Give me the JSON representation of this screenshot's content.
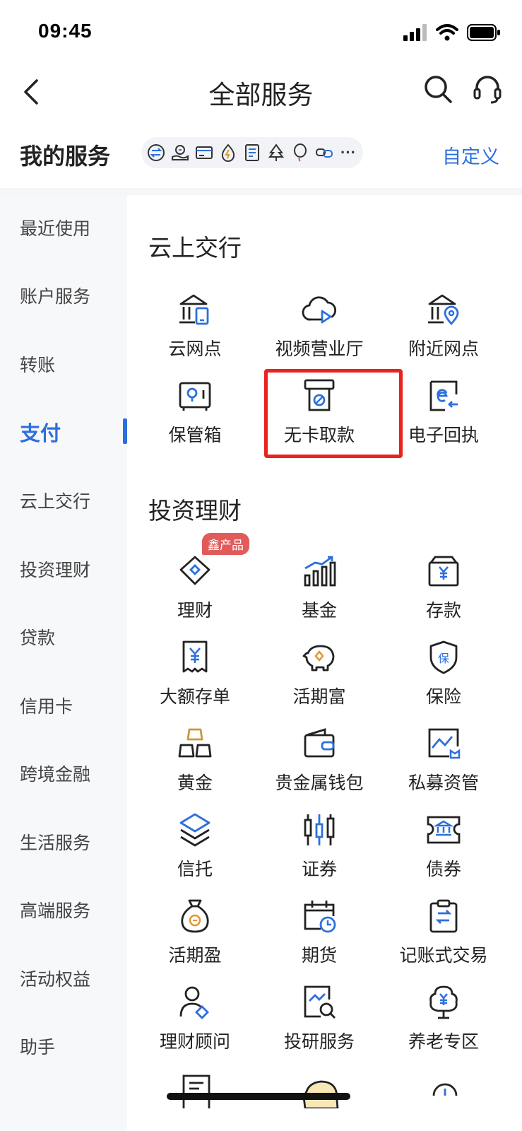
{
  "status_bar": {
    "time": "09:45"
  },
  "nav": {
    "title": "全部服务"
  },
  "my_services": {
    "title": "我的服务",
    "customize_label": "自定义",
    "icons": [
      "transfer-icon",
      "piggy-hand-icon",
      "card-icon",
      "lightning-drop-icon",
      "document-icon",
      "tree-icon",
      "balloon-icon",
      "link-icon"
    ],
    "more_label": "···"
  },
  "sidebar": {
    "items": [
      {
        "label": "最近使用"
      },
      {
        "label": "账户服务"
      },
      {
        "label": "转账"
      },
      {
        "label": "支付"
      },
      {
        "label": "云上交行"
      },
      {
        "label": "投资理财"
      },
      {
        "label": "贷款"
      },
      {
        "label": "信用卡"
      },
      {
        "label": "跨境金融"
      },
      {
        "label": "生活服务"
      },
      {
        "label": "高端服务"
      },
      {
        "label": "活动权益"
      },
      {
        "label": "助手"
      }
    ],
    "active": "支付"
  },
  "sections": [
    {
      "title": "云上交行",
      "items": [
        {
          "label": "云网点",
          "icon": "bank-phone-icon"
        },
        {
          "label": "视频营业厅",
          "icon": "cloud-video-icon"
        },
        {
          "label": "附近网点",
          "icon": "bank-location-icon"
        },
        {
          "label": "保管箱",
          "icon": "safe-box-icon"
        },
        {
          "label": "无卡取款",
          "icon": "cardless-withdraw-icon"
        },
        {
          "label": "电子回执",
          "icon": "e-receipt-icon"
        }
      ]
    },
    {
      "title": "投资理财",
      "items": [
        {
          "label": "理财",
          "icon": "diamond-icon",
          "badge": "鑫产品"
        },
        {
          "label": "基金",
          "icon": "growth-chart-icon"
        },
        {
          "label": "存款",
          "icon": "deposit-box-icon"
        },
        {
          "label": "大额存单",
          "icon": "receipt-yuan-icon"
        },
        {
          "label": "活期富",
          "icon": "piggy-bank-icon"
        },
        {
          "label": "保险",
          "icon": "shield-icon"
        },
        {
          "label": "黄金",
          "icon": "gold-bars-icon"
        },
        {
          "label": "贵金属钱包",
          "icon": "wallet-icon"
        },
        {
          "label": "私募资管",
          "icon": "image-chart-icon"
        },
        {
          "label": "信托",
          "icon": "layers-icon"
        },
        {
          "label": "证券",
          "icon": "candlestick-icon"
        },
        {
          "label": "债券",
          "icon": "bond-ticket-icon"
        },
        {
          "label": "活期盈",
          "icon": "money-bag-icon"
        },
        {
          "label": "期货",
          "icon": "calendar-clock-icon"
        },
        {
          "label": "记账式交易",
          "icon": "clipboard-transfer-icon"
        },
        {
          "label": "理财顾问",
          "icon": "advisor-icon"
        },
        {
          "label": "投研服务",
          "icon": "research-icon"
        },
        {
          "label": "养老专区",
          "icon": "pension-tree-icon"
        }
      ]
    }
  ],
  "colors": {
    "accent": "#2d6fdc",
    "highlight": "#e8231f",
    "badge": "#e25b5b"
  }
}
